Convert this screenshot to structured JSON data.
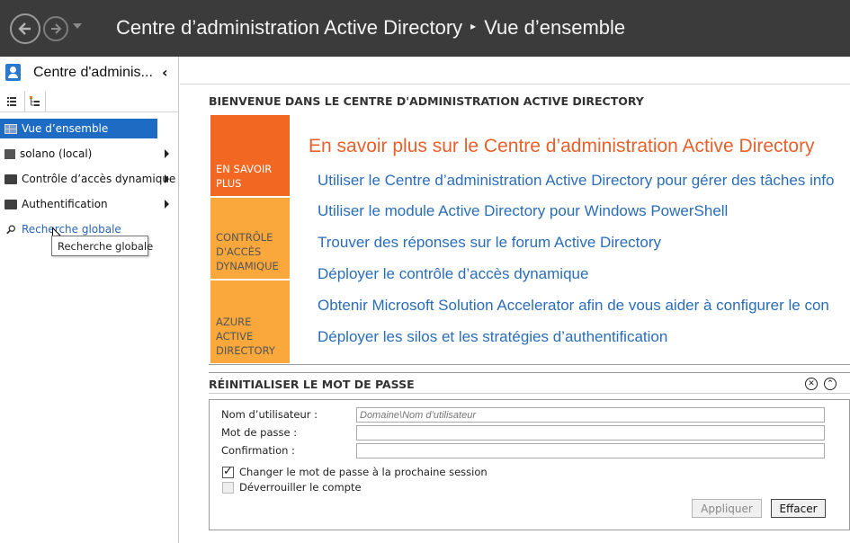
{
  "titlebar": {
    "app_name": "Centre d’administration Active Directory",
    "separator": "▸",
    "current_page": "Vue d’ensemble"
  },
  "left_pane": {
    "title": "Centre d'adminis...",
    "items": [
      {
        "label": "Vue d’ensemble",
        "icon": "overview-icon",
        "selected": true
      },
      {
        "label": "solano (local)",
        "icon": "server-icon"
      },
      {
        "label": "Contrôle d’accès dynamique",
        "icon": "folder-icon"
      },
      {
        "label": "Authentification",
        "icon": "folder-icon"
      },
      {
        "label": "Recherche globale",
        "icon": "search-icon"
      }
    ],
    "tooltip": "Recherche globale"
  },
  "welcome": {
    "section_title": "BIENVENUE DANS LE CENTRE D'ADMINISTRATION ACTIVE DIRECTORY",
    "tiles": [
      {
        "label": "EN SAVOIR PLUS",
        "color": "#f26722"
      },
      {
        "label": "CONTRÔLE D'ACCÈS DYNAMIQUE",
        "color": "#faa73c"
      },
      {
        "label": "AZURE ACTIVE DIRECTORY",
        "color": "#faa73c"
      }
    ],
    "heading": "En savoir plus sur le Centre d’administration Active Directory",
    "links": [
      "Utiliser le Centre d’administration Active Directory pour gérer des tâches info",
      "Utiliser le module Active Directory pour Windows PowerShell",
      "Trouver des réponses sur le forum Active Directory",
      "Déployer le contrôle d’accès dynamique",
      "Obtenir Microsoft Solution Accelerator afin de vous aider à configurer le con",
      "Déployer les silos et les stratégies d’authentification"
    ]
  },
  "reset_password": {
    "section_title": "RÉINITIALISER LE MOT DE PASSE",
    "username_label": "Nom d’utilisateur :",
    "username_placeholder": "Domaine\\Nom d’utilisateur",
    "password_label": "Mot de passe :",
    "confirm_label": "Confirmation :",
    "change_at_logon_label": "Changer le mot de passe à la prochaine session",
    "change_at_logon_checked": true,
    "unlock_label": "Déverrouiller le compte",
    "unlock_checked": false,
    "apply_label": "Appliquer",
    "clear_label": "Effacer"
  },
  "colors": {
    "titlebar_bg": "#3b3b3b",
    "selection": "#1e6bc4",
    "accent_orange": "#f26722",
    "accent_yellow": "#faa73c",
    "link_blue": "#2a6db9"
  }
}
